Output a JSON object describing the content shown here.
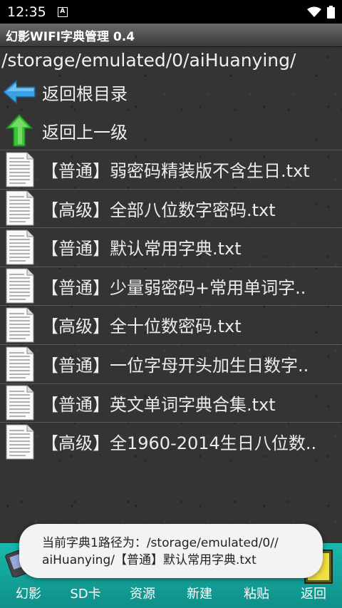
{
  "status_bar": {
    "time": "12:35",
    "notification_icon": "A"
  },
  "app": {
    "title": "幻影WIFI字典管理 0.4"
  },
  "path": "/storage/emulated/0/aiHuanying/",
  "nav": {
    "root_label": "返回根目录",
    "up_label": "返回上一级"
  },
  "files": [
    {
      "label": "【普通】弱密码精装版不含生日.txt"
    },
    {
      "label": "【高级】全部八位数字密码.txt"
    },
    {
      "label": "【普通】默认常用字典.txt"
    },
    {
      "label": "【普通】少量弱密码+常用单词字.."
    },
    {
      "label": "【高级】全十位数密码.txt"
    },
    {
      "label": "【普通】一位字母开头加生日数字.."
    },
    {
      "label": "【普通】英文单词字典合集.txt"
    },
    {
      "label": "【高级】全1960-2014生日八位数.."
    }
  ],
  "toast": {
    "line1": "当前字典1路径为：/storage/emulated/0//",
    "line2": "aiHuanying/【普通】默认常用字典.txt"
  },
  "toolbar": {
    "items": [
      {
        "label": "幻影"
      },
      {
        "label": "SD卡"
      },
      {
        "label": "资源"
      },
      {
        "label": "新建"
      },
      {
        "label": "粘贴"
      },
      {
        "label": "返回"
      }
    ]
  },
  "colors": {
    "toolbar_bg": "#13a89e",
    "toast_bg": "#f3f3f3",
    "arrow_left": "#3aa0e0",
    "arrow_up": "#3cc23c"
  }
}
